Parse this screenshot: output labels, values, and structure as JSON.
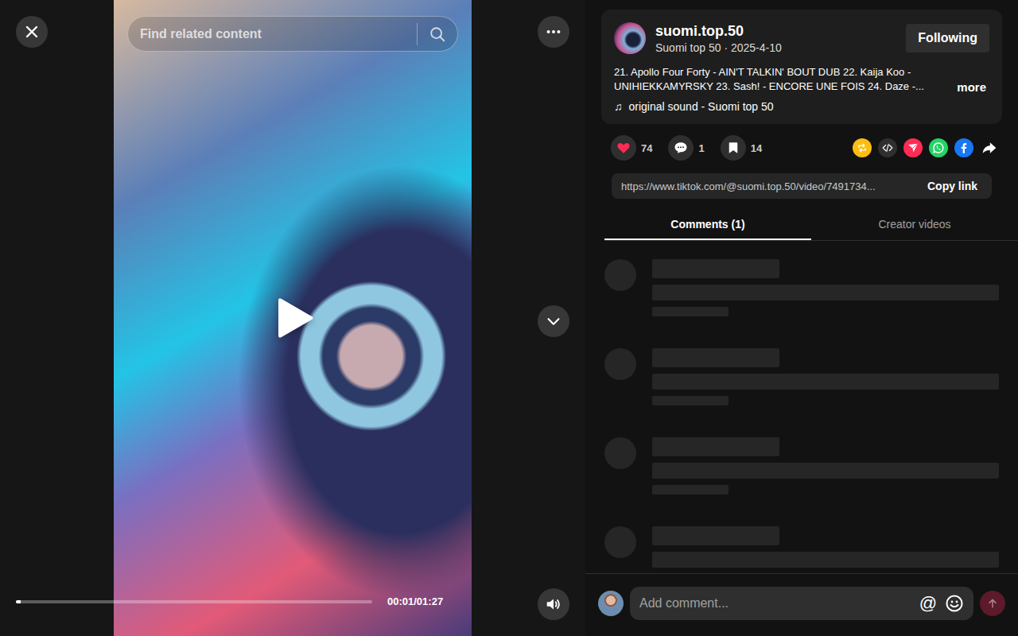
{
  "player": {
    "search_placeholder": "Find related content",
    "time": "00:01/01:27",
    "level": 0.012,
    "playing": false,
    "muted": false
  },
  "author": {
    "name": "suomi.top.50",
    "subtitle": "Suomi top 50 · 2025-4-10",
    "follow_label": "Following",
    "following": true
  },
  "description": {
    "text": "21. Apollo Four Forty - AIN'T TALKIN' BOUT DUB 22. Kaija Koo - UNIHIEKKAMYRSKY 23. Sash! - ENCORE UNE FOIS 24. Daze -...",
    "more": "more"
  },
  "sound": {
    "icon": "♫",
    "label": "original sound - Suomi top 50"
  },
  "stats": [
    {
      "kind": "like",
      "count": "74",
      "active": true
    },
    {
      "kind": "comment",
      "count": "1",
      "active": false
    },
    {
      "kind": "save",
      "count": "14",
      "active": false
    }
  ],
  "share_targets": [
    {
      "kind": "repost",
      "color": "#fbbd12"
    },
    {
      "kind": "embed",
      "color": "#2f2f2f"
    },
    {
      "kind": "send",
      "color": "#fe2c55"
    },
    {
      "kind": "whatsapp",
      "color": "#25d366"
    },
    {
      "kind": "facebook",
      "color": "#1877f2"
    },
    {
      "kind": "share",
      "color": "#1e1e1e"
    }
  ],
  "link": {
    "url": "https://www.tiktok.com/@suomi.top.50/video/7491734...",
    "copy_label": "Copy link"
  },
  "tabs": [
    {
      "label": "Comments (1)",
      "selected": true
    },
    {
      "label": "Creator videos",
      "selected": false
    }
  ],
  "comments": {
    "loading": true,
    "placeholders": 5
  },
  "comment_input": {
    "placeholder": "Add comment...",
    "mention": "@",
    "can_send": false
  }
}
